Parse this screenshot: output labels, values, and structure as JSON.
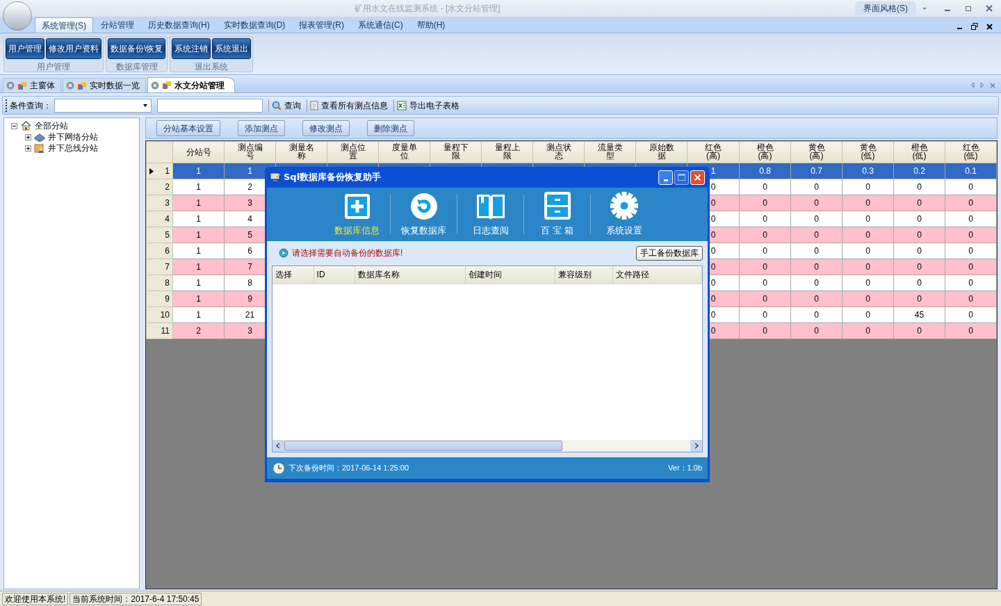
{
  "window": {
    "title": "矿用水文在线监测系统 - [水文分站管理]",
    "style_menu": "界面风格(S)"
  },
  "menu_tabs": [
    {
      "label": "系统管理(S)",
      "selected": true
    },
    {
      "label": "分站管理",
      "selected": false
    },
    {
      "label": "历史数据查询(H)",
      "selected": false
    },
    {
      "label": "实时数据查询(D)",
      "selected": false
    },
    {
      "label": "报表管理(R)",
      "selected": false
    },
    {
      "label": "系统通信(C)",
      "selected": false
    },
    {
      "label": "帮助(H)",
      "selected": false
    }
  ],
  "ribbon_groups": [
    {
      "label": "用户管理",
      "buttons": [
        "用户管理",
        "修改用户资料"
      ]
    },
    {
      "label": "数据库管理",
      "buttons": [
        "数据备份\\恢复"
      ]
    },
    {
      "label": "退出系统",
      "buttons": [
        "系统注销",
        "系统退出"
      ]
    }
  ],
  "doc_tabs": [
    {
      "label": "主窗体",
      "selected": false
    },
    {
      "label": "实时数据一览",
      "selected": false
    },
    {
      "label": "水文分站管理",
      "selected": true
    }
  ],
  "toolbar": {
    "label": "条件查询：",
    "search_button": "查询",
    "all_points_button": "查看所有测点信息",
    "export_button": "导出电子表格"
  },
  "tree": {
    "label": "全部分站",
    "expanded": true,
    "children": [
      {
        "label": "井下网络分站",
        "expanded": false
      },
      {
        "label": "井下总线分站",
        "expanded": false
      }
    ]
  },
  "station_buttons": [
    "分站基本设置",
    "添加测点",
    "修改测点",
    "删除测点"
  ],
  "grid": {
    "columns": [
      "分站号",
      "测点编号",
      "测量名称",
      "测点位置",
      "度量单位",
      "量程下限",
      "量程上限",
      "测点状态",
      "流量类型",
      "原始数据",
      "红色(高)",
      "橙色(高)",
      "黄色(高)",
      "黄色(低)",
      "橙色(低)",
      "红色(低)"
    ],
    "rows": [
      {
        "number": "1",
        "selected": true,
        "cells": [
          "1",
          "1"
        ],
        "levels": [
          "1",
          "0.8",
          "0.7",
          "0.3",
          "0.2",
          "0.1"
        ]
      },
      {
        "number": "2",
        "selected": false,
        "cells": [
          "1",
          "2"
        ],
        "levels": [
          "0",
          "0",
          "0",
          "0",
          "0",
          "0"
        ]
      },
      {
        "number": "3",
        "selected": false,
        "cells": [
          "1",
          "3"
        ],
        "levels": [
          "0",
          "0",
          "0",
          "0",
          "0",
          "0"
        ]
      },
      {
        "number": "4",
        "selected": false,
        "cells": [
          "1",
          "4"
        ],
        "levels": [
          "0",
          "0",
          "0",
          "0",
          "0",
          "0"
        ]
      },
      {
        "number": "5",
        "selected": false,
        "cells": [
          "1",
          "5"
        ],
        "levels": [
          "0",
          "0",
          "0",
          "0",
          "0",
          "0"
        ]
      },
      {
        "number": "6",
        "selected": false,
        "cells": [
          "1",
          "6"
        ],
        "levels": [
          "0",
          "0",
          "0",
          "0",
          "0",
          "0"
        ]
      },
      {
        "number": "7",
        "selected": false,
        "cells": [
          "1",
          "7"
        ],
        "levels": [
          "0",
          "0",
          "0",
          "0",
          "0",
          "0"
        ]
      },
      {
        "number": "8",
        "selected": false,
        "cells": [
          "1",
          "8"
        ],
        "levels": [
          "0",
          "0",
          "0",
          "0",
          "0",
          "0"
        ]
      },
      {
        "number": "9",
        "selected": false,
        "cells": [
          "1",
          "9"
        ],
        "levels": [
          "0",
          "0",
          "0",
          "0",
          "0",
          "0"
        ]
      },
      {
        "number": "10",
        "selected": false,
        "cells": [
          "1",
          "21"
        ],
        "levels": [
          "0",
          "0",
          "0",
          "0",
          "45",
          "0"
        ]
      },
      {
        "number": "11",
        "selected": false,
        "cells": [
          "2",
          "3"
        ],
        "levels": [
          "0",
          "0",
          "0",
          "0",
          "0",
          "0"
        ]
      }
    ]
  },
  "dialog": {
    "title": "Sql数据库备份恢复助手",
    "nav": [
      {
        "label": "数据库信息",
        "selected": true,
        "kind": "plus"
      },
      {
        "label": "恢复数据库",
        "selected": false,
        "kind": "restore"
      },
      {
        "label": "日志查阅",
        "selected": false,
        "kind": "book"
      },
      {
        "label": "百 宝 箱",
        "selected": false,
        "kind": "cabinet"
      },
      {
        "label": "系统设置",
        "selected": false,
        "kind": "gear"
      }
    ],
    "prompt": "请选择需要自动备份的数据库!",
    "manual_button": "手工备份数据库",
    "columns": [
      "选择",
      "ID",
      "数据库名称",
      "创建时间",
      "兼容级别",
      "文件路径"
    ],
    "footer": "下次备份时间：2017-06-14 1:25:00",
    "version": "Ver：1.0b"
  },
  "status_bar": [
    "欢迎使用本系统!",
    "当前系统时间：2017-6-4 17:50:45"
  ]
}
